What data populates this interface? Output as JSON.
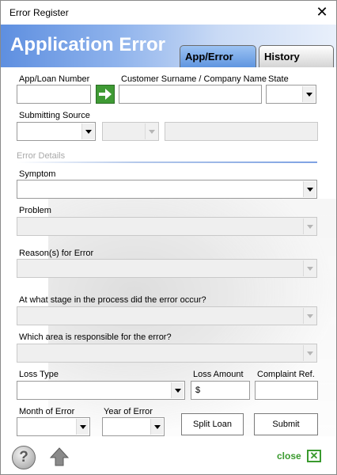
{
  "window": {
    "title": "Error Register",
    "close_glyph": "✕"
  },
  "banner": {
    "title": "Application Error"
  },
  "tabs": [
    {
      "label": "App/Error",
      "active": true
    },
    {
      "label": "History",
      "active": false
    }
  ],
  "form": {
    "app_loan_number": {
      "label": "App/Loan Number",
      "value": ""
    },
    "surname": {
      "label": "Customer Surname / Company Name",
      "value": ""
    },
    "state": {
      "label": "State",
      "value": ""
    },
    "submitting_source": {
      "label": "Submitting Source",
      "value": ""
    },
    "error_details_label": "Error Details",
    "symptom": {
      "label": "Symptom",
      "value": ""
    },
    "problem": {
      "label": "Problem",
      "value": ""
    },
    "reasons": {
      "label": "Reason(s) for Error",
      "value": ""
    },
    "stage": {
      "label": "At what stage in the process did the error occur?",
      "value": ""
    },
    "area": {
      "label": "Which area is responsible for the error?",
      "value": ""
    },
    "loss_type": {
      "label": "Loss Type",
      "value": ""
    },
    "loss_amount": {
      "label": "Loss Amount",
      "value": "$"
    },
    "complaint_ref": {
      "label": "Complaint Ref.",
      "value": ""
    },
    "month_of_error": {
      "label": "Month of Error",
      "value": ""
    },
    "year_of_error": {
      "label": "Year of Error",
      "value": ""
    }
  },
  "buttons": {
    "split_loan": "Split Loan",
    "submit": "Submit"
  },
  "footer": {
    "close_label": "close",
    "help_glyph": "?"
  },
  "icons": [
    "arrow-right-icon",
    "help-icon",
    "up-arrow-icon",
    "close-box-icon"
  ],
  "colors": {
    "accent_blue": "#5f95e0",
    "close_green": "#3a9a2e",
    "arrow_green": "#3f9a34"
  }
}
